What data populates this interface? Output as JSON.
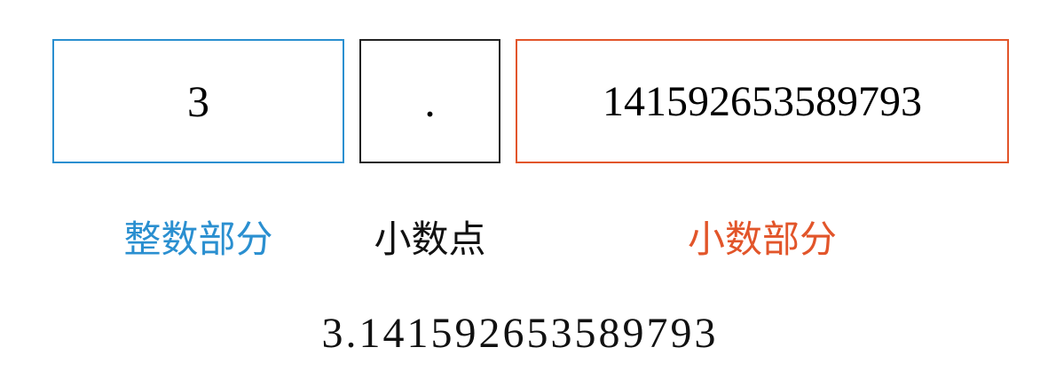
{
  "boxes": {
    "integer": {
      "value": "3",
      "caption": "整数部分",
      "color": "#2a8fd0"
    },
    "point": {
      "value": ".",
      "caption": "小数点",
      "color": "#222222"
    },
    "fraction": {
      "value": "141592653589793",
      "caption": "小数部分",
      "color": "#e2552a"
    }
  },
  "full_number": "3.141592653589793"
}
